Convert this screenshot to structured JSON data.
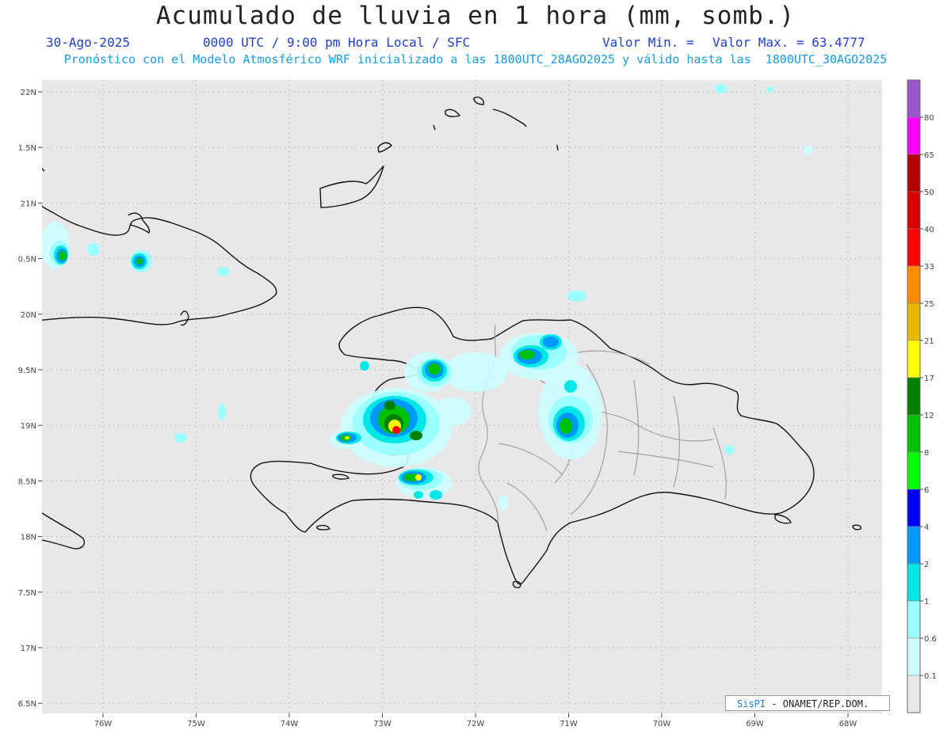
{
  "header": {
    "title": "Acumulado de lluvia en 1 hora (mm, somb.)",
    "date": "30-Ago-2025",
    "time": "0000 UTC / 9:00 pm Hora Local / SFC",
    "min_label": "Valor Min. =",
    "max_label": "Valor Max. = 63.4777",
    "model_line": "Pronóstico con el Modelo Atmosférico WRF inicializado a las 1800UTC_28AGO2025 y válido hasta las  1800UTC_30AGO2025"
  },
  "map": {
    "lon_range": [
      -76.65,
      -67.6
    ],
    "lat_range": [
      16.4,
      22.1
    ],
    "background": "#e8e8e8",
    "grid": "dotted",
    "lat_labels": [
      "22N",
      "1.5N",
      "21N",
      "0.5N",
      "20N",
      "9.5N",
      "19N",
      "8.5N",
      "18N",
      "7.5N",
      "17N",
      "6.5N"
    ],
    "lon_labels": [
      "76W",
      "75W",
      "74W",
      "73W",
      "72W",
      "71W",
      "70W",
      "69W",
      "68W"
    ]
  },
  "legend": {
    "levels": [
      "0.1",
      "0.6",
      "1",
      "2",
      "4",
      "6",
      "8",
      "12",
      "17",
      "21",
      "25",
      "33",
      "40",
      "50",
      "65",
      "80"
    ],
    "colors": [
      "#e8e8e8",
      "#ccffff",
      "#99ffff",
      "#00e6e6",
      "#0099ff",
      "#0000ff",
      "#00ff00",
      "#00c000",
      "#008000",
      "#ffff00",
      "#e6b800",
      "#ff8c00",
      "#ff0000",
      "#d90000",
      "#b30000",
      "#ff00ff",
      "#9955cc"
    ]
  },
  "credit": {
    "logo": "SisPI",
    "org": "- ONAMET/REP.DOM."
  }
}
